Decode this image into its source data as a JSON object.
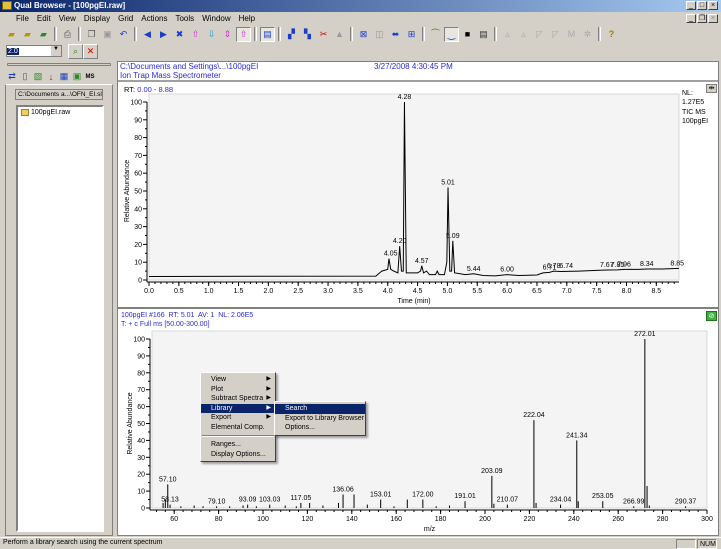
{
  "window": {
    "title": "Qual Browser - [100pgEI.raw]"
  },
  "menubar": [
    "File",
    "Edit",
    "View",
    "Display",
    "Grid",
    "Actions",
    "Tools",
    "Window",
    "Help"
  ],
  "toolbar2": {
    "zoom_value": "2.0"
  },
  "left_panel": {
    "path": "C:\\Documents a...\\OFN_EI.sld",
    "files": [
      "100pgEI.raw"
    ]
  },
  "header": {
    "path": "C:\\Documents and Settings\\...\\100pgEI",
    "instrument": "Ion Trap Mass Spectrometer",
    "datetime": "3/27/2008 4:30:45 PM"
  },
  "chromatogram": {
    "rt_label": "RT:",
    "rt_range": "0.00 - 8.88",
    "nl_label": "NL:",
    "nl_value": "1.27E5",
    "trace_label": "TIC  MS",
    "trace_file": "100pgEI"
  },
  "spectrum": {
    "header1_file": "100pgEI #166",
    "header1_rt": "RT: 5.01",
    "header1_av": "AV: 1",
    "header1_nl": "NL: 2.06E5",
    "filter": "T: + c Full ms [50.00-300.00]"
  },
  "context_menu": {
    "items": [
      {
        "label": "View",
        "sub": true
      },
      {
        "label": "Plot",
        "sub": true
      },
      {
        "label": "Subtract Spectra",
        "sub": true
      },
      {
        "label": "Library",
        "sub": true,
        "selected": true
      },
      {
        "label": "Export",
        "sub": true
      },
      {
        "label": "Elemental Comp.",
        "sub": false
      },
      {
        "sep": true
      },
      {
        "label": "Ranges...",
        "sub": false
      },
      {
        "label": "Display Options...",
        "sub": false
      }
    ],
    "submenu": [
      {
        "label": "Search",
        "selected": true
      },
      {
        "label": "Export to Library Browser"
      },
      {
        "label": "Options..."
      }
    ]
  },
  "status": {
    "text": "Perform a library search using the current spectrum",
    "num": "NUM"
  },
  "chart_data": [
    {
      "type": "line",
      "xlabel": "Time (min)",
      "ylabel": "Relative Abundance",
      "xlim": [
        0,
        8.88
      ],
      "ylim": [
        0,
        100
      ],
      "xticks": [
        0.0,
        0.5,
        1.0,
        1.5,
        2.0,
        2.5,
        3.0,
        3.5,
        4.0,
        4.5,
        5.0,
        5.5,
        6.0,
        6.5,
        7.0,
        7.5,
        8.0,
        8.5
      ],
      "yticks": [
        0,
        10,
        20,
        30,
        40,
        50,
        60,
        70,
        80,
        90,
        100
      ],
      "points": [
        [
          3.9,
          5
        ],
        [
          4.0,
          6
        ],
        [
          4.02,
          12
        ],
        [
          4.05,
          6
        ],
        [
          4.1,
          5
        ],
        [
          4.17,
          4
        ],
        [
          4.2,
          19
        ],
        [
          4.23,
          5
        ],
        [
          4.26,
          5
        ],
        [
          4.28,
          100
        ],
        [
          4.31,
          4
        ],
        [
          4.4,
          4
        ],
        [
          4.5,
          4
        ],
        [
          4.55,
          5
        ],
        [
          4.57,
          8
        ],
        [
          4.6,
          4
        ],
        [
          4.65,
          5
        ],
        [
          4.7,
          3
        ],
        [
          4.8,
          3
        ],
        [
          4.83,
          5
        ],
        [
          4.86,
          3
        ],
        [
          4.95,
          3
        ],
        [
          4.99,
          10
        ],
        [
          5.01,
          52
        ],
        [
          5.04,
          5
        ],
        [
          5.07,
          5
        ],
        [
          5.09,
          22
        ],
        [
          5.12,
          4
        ],
        [
          5.3,
          3
        ],
        [
          5.44,
          3.5
        ],
        [
          5.6,
          2.5
        ],
        [
          5.8,
          2.3
        ],
        [
          6.0,
          3
        ],
        [
          6.2,
          2.5
        ],
        [
          6.5,
          2.8
        ],
        [
          6.6,
          4
        ],
        [
          6.71,
          4.3
        ],
        [
          6.78,
          5
        ],
        [
          6.9,
          4.8
        ],
        [
          7.2,
          5
        ],
        [
          7.5,
          5.4
        ],
        [
          7.67,
          5.6
        ],
        [
          7.85,
          5.7
        ],
        [
          7.96,
          6
        ],
        [
          8.2,
          6
        ],
        [
          8.34,
          6.2
        ],
        [
          8.6,
          6.2
        ],
        [
          8.88,
          6.5
        ]
      ],
      "peak_labels": [
        {
          "x": 4.05,
          "y": 12,
          "label": "4.05"
        },
        {
          "x": 4.2,
          "y": 19,
          "label": "4.20"
        },
        {
          "x": 4.28,
          "y": 100,
          "label": "4.28"
        },
        {
          "x": 4.57,
          "y": 8,
          "label": "4.57"
        },
        {
          "x": 5.01,
          "y": 52,
          "label": "5.01"
        },
        {
          "x": 5.09,
          "y": 22,
          "label": "5.09"
        },
        {
          "x": 5.44,
          "y": 3.5,
          "label": "5.44"
        },
        {
          "x": 6.0,
          "y": 3,
          "label": "6.00"
        },
        {
          "x": 6.71,
          "y": 4.3,
          "label": "6.71"
        },
        {
          "x": 6.78,
          "y": 5,
          "label": "6.78"
        },
        {
          "x": 6.74,
          "y": 5,
          "label": "6.74",
          "dx": 0.25
        },
        {
          "x": 7.67,
          "y": 5.6,
          "label": "7.67"
        },
        {
          "x": 7.85,
          "y": 5.7,
          "label": "7.85"
        },
        {
          "x": 7.96,
          "y": 6,
          "label": "7.96"
        },
        {
          "x": 8.34,
          "y": 6.2,
          "label": "8.34"
        },
        {
          "x": 8.85,
          "y": 6.5,
          "label": "8.85"
        }
      ]
    },
    {
      "type": "bar",
      "xlabel": "m/z",
      "ylabel": "Relative Abundance",
      "xlim": [
        50,
        300
      ],
      "ylim": [
        0,
        100
      ],
      "xticks": [
        60,
        80,
        100,
        120,
        140,
        160,
        180,
        200,
        220,
        240,
        260,
        280,
        300
      ],
      "yticks": [
        0,
        10,
        20,
        30,
        40,
        50,
        60,
        70,
        80,
        90,
        100
      ],
      "peaks": [
        [
          55,
          3
        ],
        [
          56,
          5
        ],
        [
          57.1,
          14
        ],
        [
          58.13,
          2
        ],
        [
          63,
          1
        ],
        [
          69,
          1.5
        ],
        [
          73,
          1
        ],
        [
          79.1,
          1
        ],
        [
          85,
          1
        ],
        [
          91,
          1.5
        ],
        [
          93.09,
          2
        ],
        [
          97,
          1
        ],
        [
          103.03,
          2
        ],
        [
          110,
          1.5
        ],
        [
          115,
          1
        ],
        [
          117.05,
          3
        ],
        [
          121,
          3
        ],
        [
          127,
          1.5
        ],
        [
          134,
          3
        ],
        [
          136.06,
          8
        ],
        [
          141,
          8
        ],
        [
          147,
          2
        ],
        [
          153.01,
          5
        ],
        [
          159,
          1
        ],
        [
          165,
          5
        ],
        [
          172.0,
          5
        ],
        [
          178,
          1
        ],
        [
          184,
          1.5
        ],
        [
          191.01,
          4
        ],
        [
          203.09,
          19
        ],
        [
          204,
          2.5
        ],
        [
          210.07,
          2
        ],
        [
          222.04,
          52
        ],
        [
          223,
          3
        ],
        [
          234.04,
          2
        ],
        [
          241.34,
          40
        ],
        [
          242,
          4
        ],
        [
          253.05,
          4
        ],
        [
          266.99,
          1
        ],
        [
          272.01,
          100
        ],
        [
          273,
          13
        ],
        [
          274,
          1.5
        ],
        [
          290.37,
          1
        ]
      ],
      "peak_labels": [
        "57.10",
        "58.13",
        "79.10",
        "93.09",
        "103.03",
        "117.05",
        "136.06",
        "153.01",
        "172.00",
        "191.01",
        "203.09",
        "210.07",
        "222.04",
        "234.04",
        "241.34",
        "253.05",
        "266.99",
        "272.01",
        "290.37"
      ]
    }
  ],
  "colors": {
    "title_start": "#0a246a",
    "header_text": "#2a2ad0",
    "trace": "#000000",
    "label_marker": "#6cc86c"
  }
}
